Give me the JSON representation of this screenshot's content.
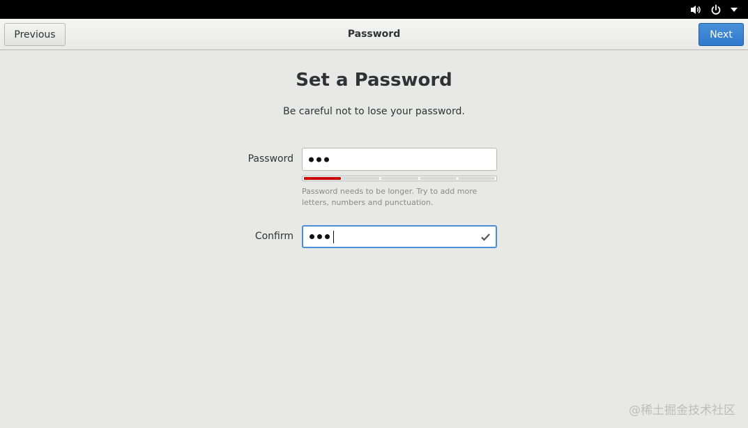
{
  "topbar": {
    "icons": [
      "volume-icon",
      "power-icon",
      "menu-arrow-icon"
    ]
  },
  "header": {
    "title": "Password",
    "previous_label": "Previous",
    "next_label": "Next"
  },
  "main": {
    "title": "Set a Password",
    "subtitle": "Be careful not to lose your password.",
    "password": {
      "label": "Password",
      "masked_length": 3,
      "strength_segments": 5,
      "strength_filled": 1,
      "strength_color": "#cc0000",
      "hint": "Password needs to be longer. Try to add more letters, numbers and punctuation."
    },
    "confirm": {
      "label": "Confirm",
      "masked_length": 3,
      "match_icon": "checkmark-icon"
    }
  },
  "watermark": "@稀土掘金技术社区",
  "colors": {
    "accent": "#4a90d9",
    "background": "#e8e8e7",
    "topbar": "#000000"
  }
}
